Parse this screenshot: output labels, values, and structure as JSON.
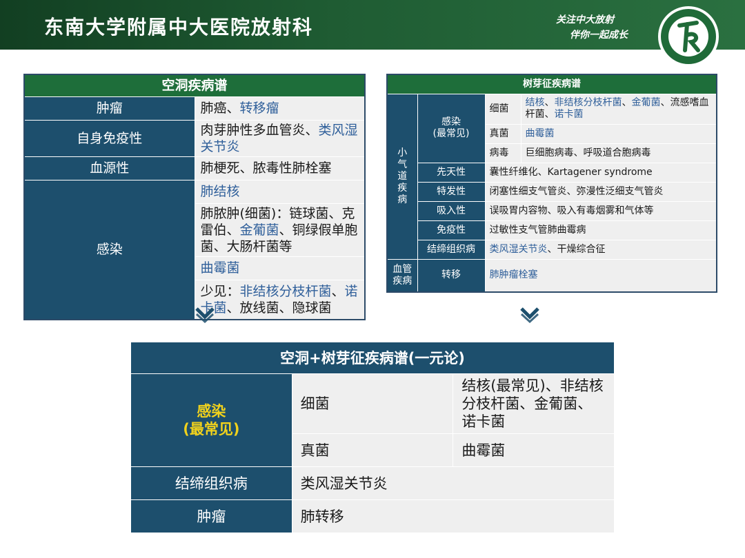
{
  "header": {
    "title": "东南大学附属中大医院放射科",
    "slogan_line1": "关注中大放射",
    "slogan_line2": "伴你一起成长"
  },
  "left_table": {
    "title": "空洞疾病谱",
    "rows": {
      "tumor": {
        "label": "肿瘤",
        "plain": "肺癌、",
        "link": "转移瘤"
      },
      "autoimmune": {
        "label": "自身免疫性",
        "plain": "肉芽肿性多血管炎、",
        "link": "类风湿关节炎"
      },
      "hematogenous": {
        "label": "血源性",
        "plain": "肺梗死、脓毒性肺栓塞"
      },
      "infection": {
        "label": "感染",
        "tb": "肺结核",
        "abscess_plain1": "肺脓肿(细菌)：链球菌、克雷伯、",
        "abscess_link": "金葡菌",
        "abscess_plain2": "、铜绿假单胞菌、大肠杆菌等",
        "aspergillus": "曲霉菌",
        "rare_prefix": "少见：",
        "rare_link1": "非结核分枝杆菌",
        "rare_sep": "、",
        "rare_link2": "诺卡菌",
        "rare_suffix": "、放线菌、隐球菌"
      }
    }
  },
  "right_table": {
    "title": "树芽征疾病谱",
    "small_airway_label": "小气道疾病",
    "infection_label": "感染",
    "infection_note": "(最常见)",
    "bacteria": {
      "label": "细菌",
      "link1": "结核",
      "sep1": "、",
      "link2": "非结核分枝杆菌",
      "sep2": "、",
      "link3": "金葡菌",
      "plain": "、流感嗜血杆菌、",
      "link4": "诺卡菌"
    },
    "fungi": {
      "label": "真菌",
      "link": "曲霉菌"
    },
    "virus": {
      "label": "病毒",
      "value": "巨细胞病毒、呼吸道合胞病毒"
    },
    "congenital": {
      "label": "先天性",
      "value": "囊性纤维化、Kartagener syndrome"
    },
    "idiopathic": {
      "label": "特发性",
      "value": "闭塞性细支气管炎、弥漫性泛细支气管炎"
    },
    "inhalation": {
      "label": "吸入性",
      "value": "误吸胃内容物、吸入有毒烟雾和气体等"
    },
    "immune": {
      "label": "免疫性",
      "value": "过敏性支气管肺曲霉病"
    },
    "connective": {
      "label": "结缔组织病",
      "link": "类风湿关节炎",
      "plain": "、干燥综合征"
    },
    "vascular_label": "血管疾病",
    "metastasis": {
      "label": "转移",
      "link": "肺肿瘤栓塞"
    }
  },
  "bottom_table": {
    "title": "空洞+树芽征疾病谱(一元论)",
    "infection_label": "感染",
    "infection_note": "(最常见)",
    "bacteria": {
      "label": "细菌",
      "value": "结核(最常见)、非结核分枝杆菌、金葡菌、诺卡菌"
    },
    "fungi": {
      "label": "真菌",
      "value": "曲霉菌"
    },
    "connective": {
      "label": "结缔组织病",
      "value": "类风湿关节炎"
    },
    "tumor": {
      "label": "肿瘤",
      "value": "肺转移"
    }
  },
  "colors": {
    "header_green": "#1e6e3a",
    "cell_blue": "#1d4f6d",
    "link_blue": "#2f5f9a",
    "highlight_yellow": "#f1d21c",
    "cell_gray": "#efefef"
  },
  "icons": {
    "arrow": "chevron-down-icon",
    "logo": "hospital-radiology-logo"
  }
}
